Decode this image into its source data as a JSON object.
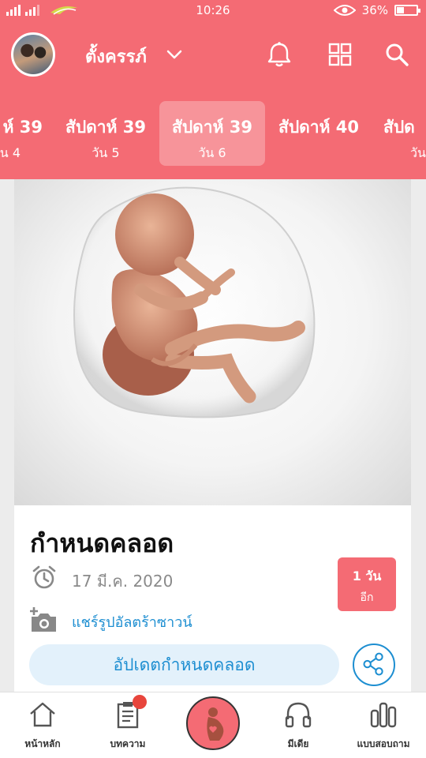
{
  "status_bar": {
    "time": "10:26",
    "battery": "36%"
  },
  "profile": {
    "name": "ตั้งครรภ์"
  },
  "week_tabs": [
    {
      "week": "ห์ 39",
      "day": "น 4"
    },
    {
      "week": "สัปดาห์ 39",
      "day": "วัน 5"
    },
    {
      "week": "สัปดาห์ 39",
      "day": "วัน 6"
    },
    {
      "week": "สัปดาห์ 40",
      "day": ""
    },
    {
      "week": "สัปด",
      "day": "วัน"
    }
  ],
  "card": {
    "title": "กำหนดคลอด",
    "due_date": "17 มี.ค. 2020",
    "days_left_value": "1 วัน",
    "days_left_suffix": "อีก",
    "share_ultrasound": "แชร์รูปอัลตร้าซาวน์",
    "update_button": "อัปเดตกำหนดคลอด"
  },
  "bottom_nav": [
    {
      "label": "หน้าหลัก",
      "icon": "home-icon"
    },
    {
      "label": "บทความ",
      "icon": "article-icon"
    },
    {
      "label": "",
      "icon": "pregnancy-icon"
    },
    {
      "label": "มีเดีย",
      "icon": "headphones-icon"
    },
    {
      "label": "แบบสอบถาม",
      "icon": "poll-icon"
    }
  ],
  "colors": {
    "primary": "#f46b74",
    "link": "#1d8ed1",
    "badge": "#e8453c"
  }
}
